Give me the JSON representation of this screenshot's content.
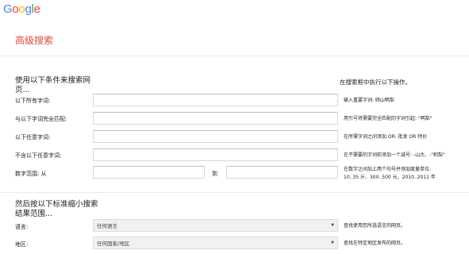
{
  "header": {
    "logo_letters": [
      {
        "ch": "G",
        "color": "#4285F4"
      },
      {
        "ch": "o",
        "color": "#EA4335"
      },
      {
        "ch": "o",
        "color": "#FBBC05"
      },
      {
        "ch": "g",
        "color": "#4285F4"
      },
      {
        "ch": "l",
        "color": "#34A853"
      },
      {
        "ch": "e",
        "color": "#EA4335"
      }
    ],
    "page_title": "高级搜索"
  },
  "find": {
    "heading": "使用以下条件来搜索网页...",
    "right_heading": "在搜索框中执行以下操作。",
    "rows": [
      {
        "label": "以下所有字词:",
        "value": "",
        "hint": "输入重要字词: 砀山鸭梨",
        "hint_mono": ""
      },
      {
        "label": "与以下字词完全匹配:",
        "value": "",
        "hint": "用引号将需要完全匹配的字词引起: \"鸭梨\"",
        "hint_mono": ""
      },
      {
        "label": "以下任意字词:",
        "value": "",
        "hint": "在所需字词之间添加 OR: 批发 OR 特价",
        "hint_mono": ""
      },
      {
        "label": "不含以下任意字词:",
        "value": "",
        "hint": "在不需要的字词前添加一个减号: -山大、-\"刺梨\"",
        "hint_mono": ""
      }
    ],
    "range": {
      "label": "数字范围: 从",
      "to_label": "到",
      "from_value": "",
      "to_value": "",
      "hint_line1": "在数字之间加上两个句号并添加度量单位:",
      "hint_line2": "10..35 斤、300..500 元、2010..2011 年"
    }
  },
  "narrow": {
    "heading": "然后按以下标准缩小搜索结果范围...",
    "rows": [
      {
        "label": "语言:",
        "selected": "任何语言",
        "hint": "查找使用您所选语言的网页。"
      },
      {
        "label": "地区:",
        "selected": "任何国家/地区",
        "hint": "查找在特定地区发布的网页。"
      }
    ]
  }
}
